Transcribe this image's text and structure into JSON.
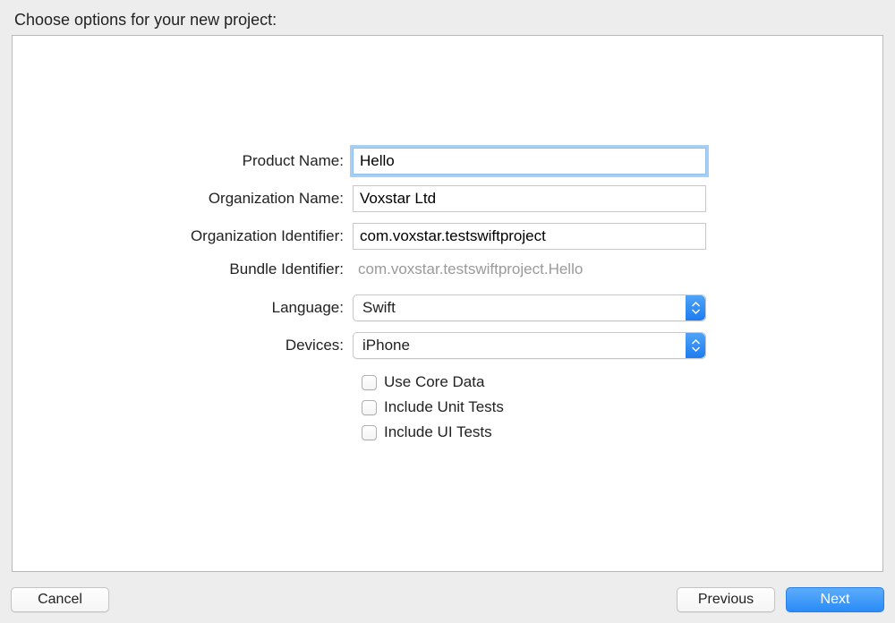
{
  "header": "Choose options for your new project:",
  "form": {
    "product_name": {
      "label": "Product Name:",
      "value": "Hello"
    },
    "org_name": {
      "label": "Organization Name:",
      "value": "Voxstar Ltd"
    },
    "org_identifier": {
      "label": "Organization Identifier:",
      "value": "com.voxstar.testswiftproject"
    },
    "bundle_identifier": {
      "label": "Bundle Identifier:",
      "value": "com.voxstar.testswiftproject.Hello"
    },
    "language": {
      "label": "Language:",
      "value": "Swift"
    },
    "devices": {
      "label": "Devices:",
      "value": "iPhone"
    },
    "checkboxes": {
      "core_data": "Use Core Data",
      "unit_tests": "Include Unit Tests",
      "ui_tests": "Include UI Tests"
    }
  },
  "footer": {
    "cancel": "Cancel",
    "previous": "Previous",
    "next": "Next"
  }
}
